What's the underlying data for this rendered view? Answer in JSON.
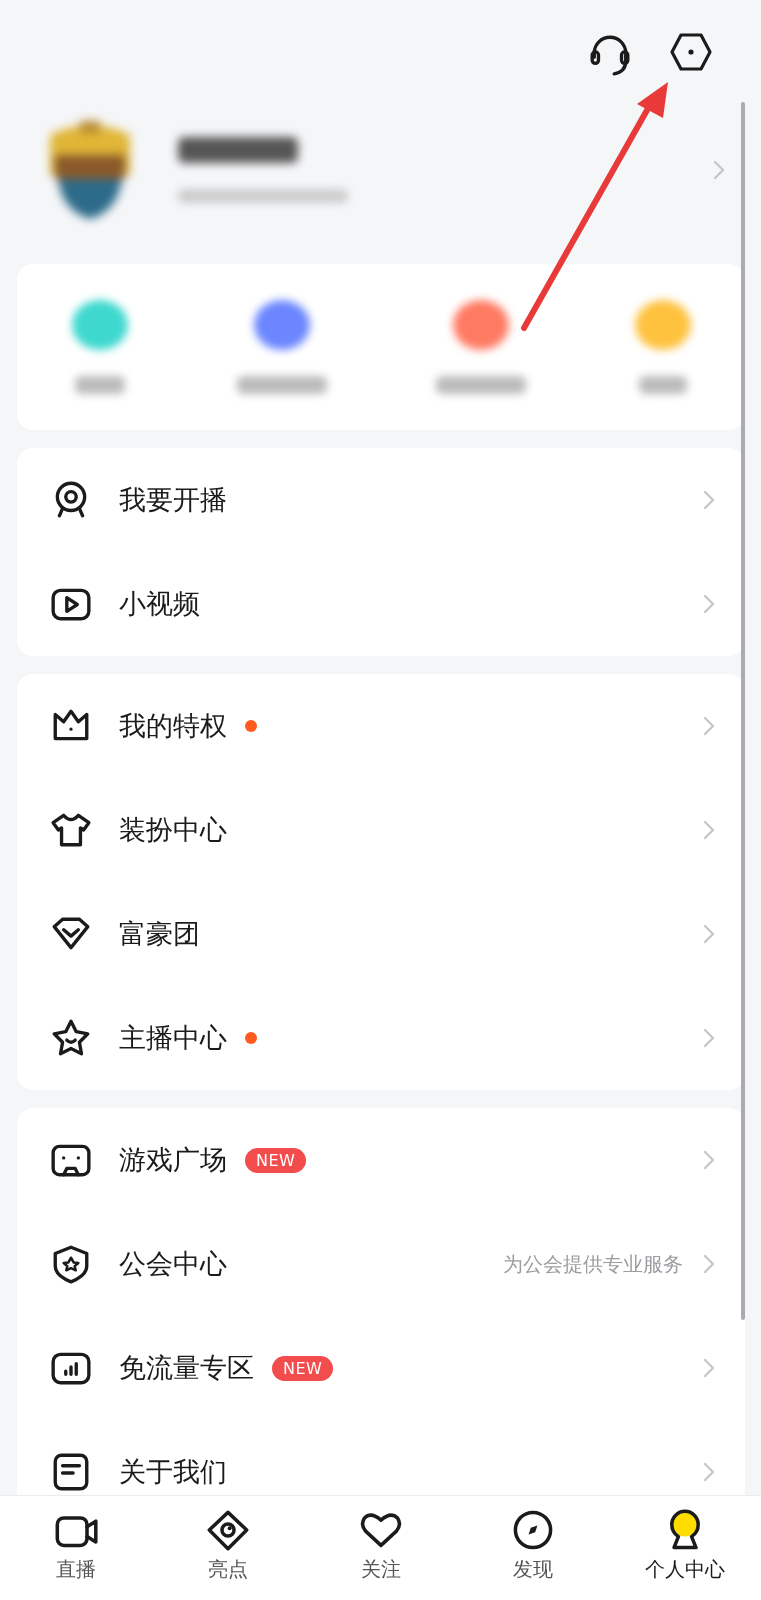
{
  "shortcuts": [
    {
      "color": "#3ed8cf"
    },
    {
      "color": "#6b86ff"
    },
    {
      "color": "#ff7a62"
    },
    {
      "color": "#ffc23f"
    }
  ],
  "menu_groups": [
    {
      "items": [
        {
          "label": "我要开播",
          "dot": false
        },
        {
          "label": "小视频",
          "dot": false
        }
      ]
    },
    {
      "items": [
        {
          "label": "我的特权",
          "dot": true
        },
        {
          "label": "装扮中心",
          "dot": false
        },
        {
          "label": "富豪团",
          "dot": false
        },
        {
          "label": "主播中心",
          "dot": true
        }
      ]
    },
    {
      "items": [
        {
          "label": "游戏广场",
          "dot": false,
          "tag": "NEW"
        },
        {
          "label": "公会中心",
          "dot": false,
          "subtitle": "为公会提供专业服务"
        },
        {
          "label": "免流量专区",
          "dot": false,
          "tag": "NEW"
        },
        {
          "label": "关于我们",
          "dot": false
        }
      ]
    }
  ],
  "tab_bar": [
    {
      "label": "直播",
      "selected": false
    },
    {
      "label": "亮点",
      "selected": false
    },
    {
      "label": "关注",
      "selected": false
    },
    {
      "label": "发现",
      "selected": false
    },
    {
      "label": "个人中心",
      "selected": true
    }
  ]
}
